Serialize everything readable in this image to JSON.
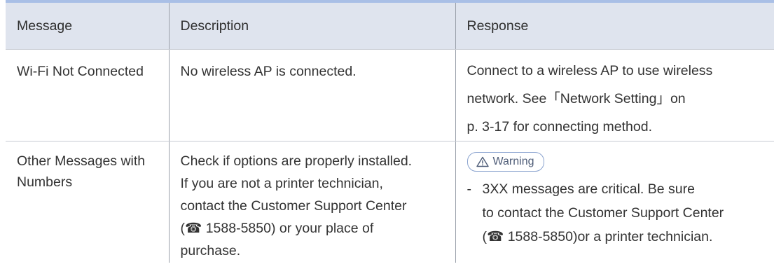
{
  "table": {
    "headers": [
      "Message",
      "Description",
      "Response"
    ],
    "rows": [
      {
        "message": "Wi-Fi Not Connected",
        "description": "No wireless AP is connected.",
        "response": "Connect to a wireless AP to use wireless\nnetwork. See「Network Setting」on\np. 3-17 for connecting method."
      },
      {
        "message": "Other Messages with\nNumbers",
        "description": "Check if options are properly installed.\nIf you are not a printer technician,\ncontact the Customer Support Center\n(☎ 1588-5850) or your place of\npurchase.",
        "warning_label": "Warning",
        "warning_dash": "-",
        "warning_text": "3XX messages are critical. Be sure\nto contact the Customer Support Center\n(☎ 1588-5850)or a printer technician."
      }
    ]
  },
  "colors": {
    "header_bg": "#dfe4ee",
    "top_rule": "#a9bfe6",
    "badge_border": "#8aa3cf"
  },
  "icons": {
    "warning": "warning-triangle-icon"
  }
}
